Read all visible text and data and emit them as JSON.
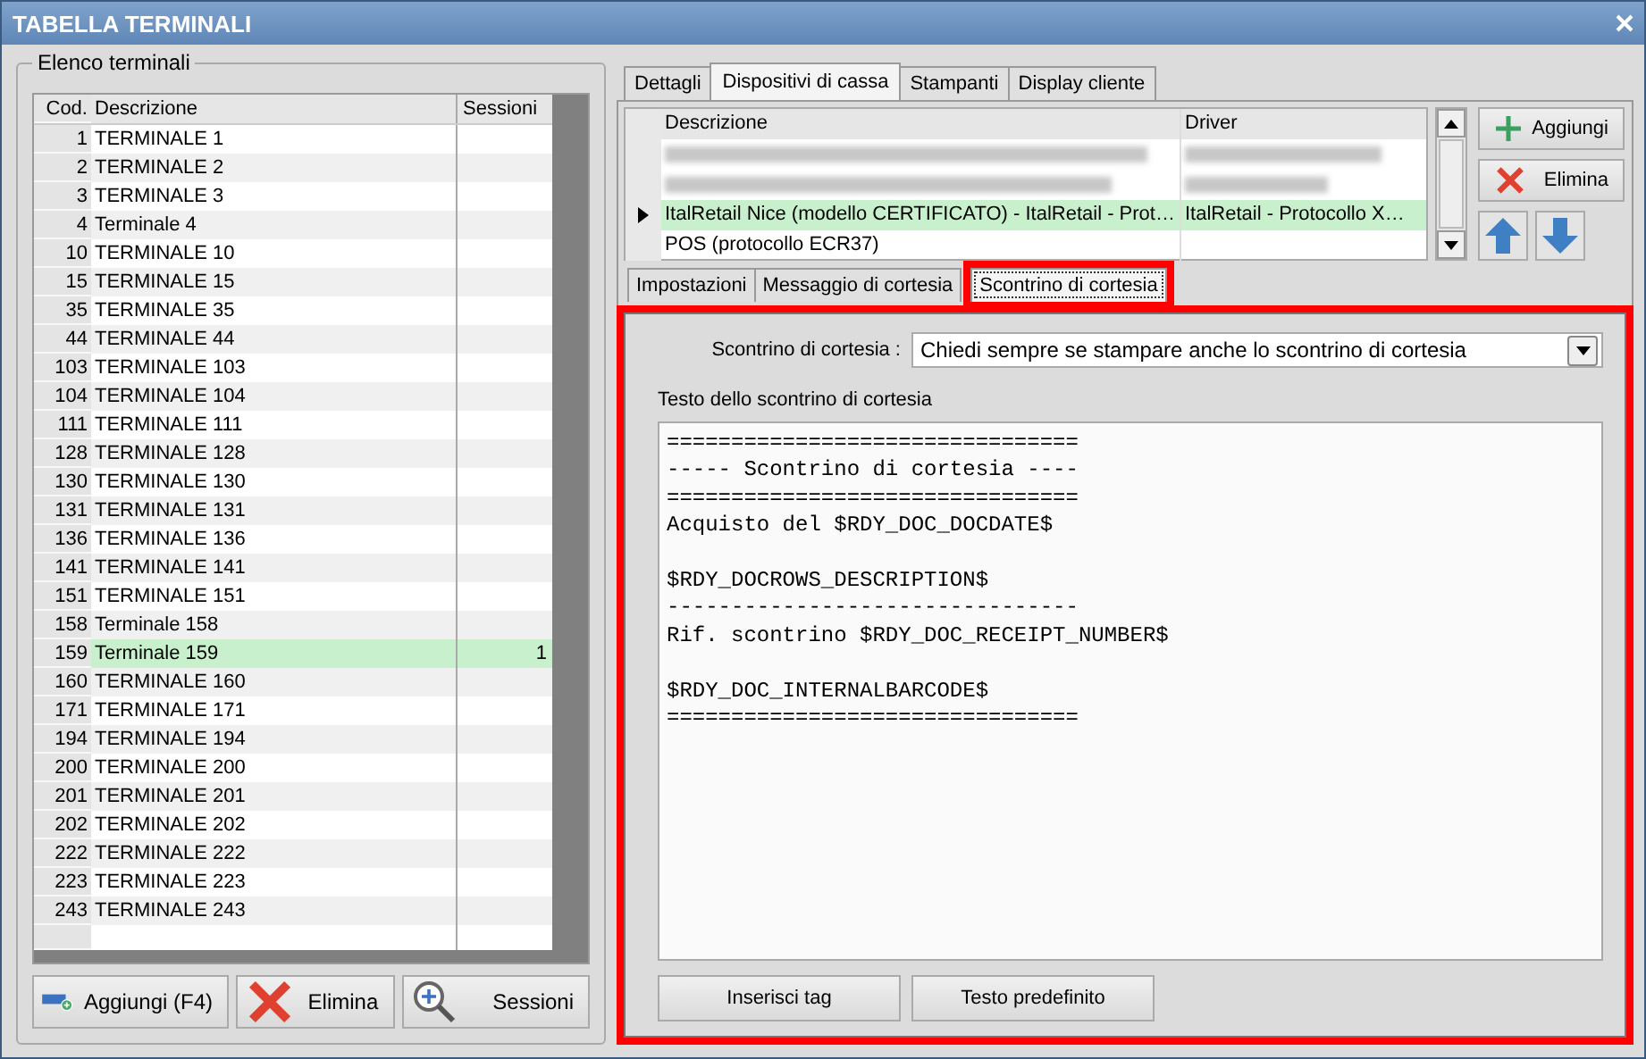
{
  "window": {
    "title": "TABELLA TERMINALI"
  },
  "terminal_list": {
    "title": "Elenco terminali",
    "columns": [
      "Cod.",
      "Descrizione",
      "Sessioni"
    ],
    "rows": [
      {
        "code": "1",
        "description": "TERMINALE 1",
        "selected": false
      },
      {
        "code": "2",
        "description": "TERMINALE 2",
        "selected": false
      },
      {
        "code": "3",
        "description": "TERMINALE 3",
        "selected": false
      },
      {
        "code": "4",
        "description": "Terminale 4",
        "selected": false
      },
      {
        "code": "10",
        "description": "TERMINALE 10",
        "selected": false
      },
      {
        "code": "15",
        "description": "TERMINALE 15",
        "selected": false
      },
      {
        "code": "35",
        "description": "TERMINALE 35",
        "selected": false
      },
      {
        "code": "44",
        "description": "TERMINALE 44",
        "selected": false
      },
      {
        "code": "103",
        "description": "TERMINALE 103",
        "selected": false
      },
      {
        "code": "104",
        "description": "TERMINALE 104",
        "selected": false
      },
      {
        "code": "111",
        "description": "TERMINALE 111",
        "selected": false
      },
      {
        "code": "128",
        "description": "TERMINALE 128",
        "selected": false
      },
      {
        "code": "130",
        "description": "TERMINALE 130",
        "selected": false
      },
      {
        "code": "131",
        "description": "TERMINALE 131",
        "selected": false
      },
      {
        "code": "136",
        "description": "TERMINALE 136",
        "selected": false
      },
      {
        "code": "141",
        "description": "TERMINALE 141",
        "selected": false
      },
      {
        "code": "151",
        "description": "TERMINALE 151",
        "selected": false
      },
      {
        "code": "158",
        "description": "Terminale 158",
        "selected": false
      },
      {
        "code": "159",
        "description": "Terminale 159",
        "sessions": "1",
        "selected": true
      },
      {
        "code": "160",
        "description": "TERMINALE 160",
        "selected": false
      },
      {
        "code": "171",
        "description": "TERMINALE 171",
        "selected": false
      },
      {
        "code": "194",
        "description": "TERMINALE 194",
        "selected": false
      },
      {
        "code": "200",
        "description": "TERMINALE 200",
        "selected": false
      },
      {
        "code": "201",
        "description": "TERMINALE 201",
        "selected": false
      },
      {
        "code": "202",
        "description": "TERMINALE 202",
        "selected": false
      },
      {
        "code": "222",
        "description": "TERMINALE 222",
        "selected": false
      },
      {
        "code": "223",
        "description": "TERMINALE 223",
        "selected": false
      },
      {
        "code": "243",
        "description": "TERMINALE 243",
        "selected": false
      }
    ],
    "buttons": [
      {
        "kind": "add",
        "label": "Aggiungi (F4)"
      },
      {
        "kind": "delete",
        "label": "Elimina"
      },
      {
        "kind": "search",
        "label": "Sessioni"
      }
    ]
  },
  "tabs": [
    {
      "label": "Dettagli",
      "selected": false
    },
    {
      "label": "Dispositivi di cassa",
      "selected": true
    },
    {
      "label": "Stampanti",
      "selected": false
    },
    {
      "label": "Display cliente",
      "selected": false
    }
  ],
  "devices": {
    "columns": [
      "Descrizione",
      "Driver"
    ],
    "rows": [
      {
        "kind": "blurred",
        "selected": false
      },
      {
        "kind": "blurred",
        "selected": false
      },
      {
        "kind": "text",
        "description": "ItalRetail Nice (modello CERTIFICATO) - ItalRetail - Prot…",
        "driver": "ItalRetail - Protocollo X…",
        "selected": true
      },
      {
        "kind": "text",
        "description": "POS (protocollo ECR37)",
        "selected": false
      }
    ],
    "buttons": [
      {
        "kind": "add",
        "label": "Aggiungi"
      },
      {
        "kind": "delete",
        "label": "Elimina"
      }
    ]
  },
  "subtabs": [
    {
      "label": "Impostazioni",
      "selected": false,
      "highlighted": false
    },
    {
      "label": "Messaggio di cortesia",
      "selected": false,
      "highlighted": false
    },
    {
      "label": "Scontrino di cortesia",
      "selected": true,
      "highlighted": true
    }
  ],
  "panel": {
    "highlighted": true,
    "select_label": "Scontrino di cortesia :",
    "select_value": "Chiedi sempre se stampare anche lo scontrino di cortesia",
    "text_label": "Testo dello scontrino di cortesia",
    "text": "================================\n----- Scontrino di cortesia ----\n================================\nAcquisto del $RDY_DOC_DOCDATE$\n\n$RDY_DOCROWS_DESCRIPTION$\n--------------------------------\nRif. scontrino $RDY_DOC_RECEIPT_NUMBER$\n\n$RDY_DOC_INTERNALBARCODE$\n================================",
    "buttons": [
      "Inserisci tag",
      "Testo predefinito"
    ]
  }
}
